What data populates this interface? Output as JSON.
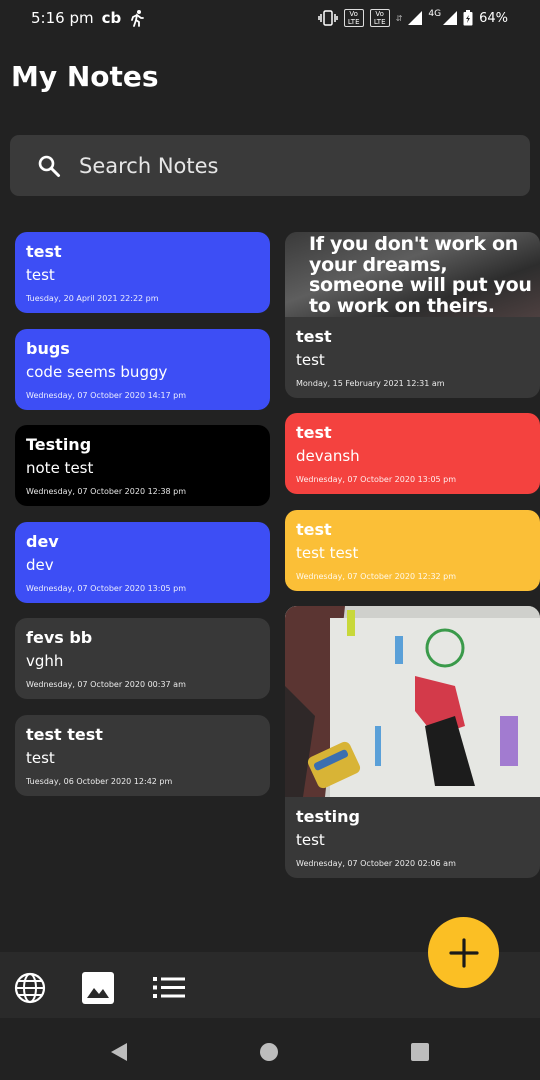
{
  "status_bar": {
    "time": "5:16 pm",
    "carrier": "cb",
    "battery": "64%",
    "network": "4G",
    "volte_1": "Vo LTE",
    "volte_2": "Vo LTE"
  },
  "header": {
    "title": "My Notes"
  },
  "search": {
    "placeholder": "Search Notes"
  },
  "colors": {
    "blue": "#3d4ef5",
    "black": "#000000",
    "dark": "#383838",
    "red": "#f4423f",
    "yellow": "#fbbf37",
    "fab": "#fbbf24"
  },
  "notes_left": [
    {
      "title": "test",
      "text": "test",
      "date": "Tuesday, 20 April 2021 22:22 pm",
      "color": "blue"
    },
    {
      "title": "bugs",
      "text": "code seems buggy",
      "date": "Wednesday, 07 October 2020 14:17 pm",
      "color": "blue"
    },
    {
      "title": "Testing",
      "text": "note test",
      "date": "Wednesday, 07 October 2020 12:38 pm",
      "color": "black"
    },
    {
      "title": "dev",
      "text": "dev",
      "date": "Wednesday, 07 October 2020 13:05 pm",
      "color": "blue"
    },
    {
      "title": "fevs bb",
      "text": "vghh",
      "date": "Wednesday, 07 October 2020 00:37 am",
      "color": "dark"
    },
    {
      "title": "test test",
      "text": "test",
      "date": "Tuesday, 06 October 2020 12:42 pm",
      "color": "dark"
    }
  ],
  "notes_right": [
    {
      "title": "test",
      "text": "test",
      "date": "Monday, 15 February 2021 12:31 am",
      "color": "dark",
      "image": "quote-image",
      "image_text": "If you don't work on your dreams, someone will put you to work on theirs."
    },
    {
      "title": "test",
      "text": "devansh",
      "date": "Wednesday, 07 October 2020 13:05 pm",
      "color": "red"
    },
    {
      "title": "test",
      "text": "test test",
      "date": "Wednesday, 07 October 2020 12:32 pm",
      "color": "yellow"
    },
    {
      "title": "testing",
      "text": "test",
      "date": "Wednesday, 07 October 2020 02:06 am",
      "color": "dark",
      "image": "photo-image"
    }
  ],
  "bottom_bar": {
    "icons": [
      "globe-icon",
      "image-icon",
      "list-icon"
    ],
    "fab_icon": "plus-icon"
  },
  "nav_bar": {
    "icons": [
      "back-icon",
      "home-icon",
      "recents-icon"
    ]
  }
}
